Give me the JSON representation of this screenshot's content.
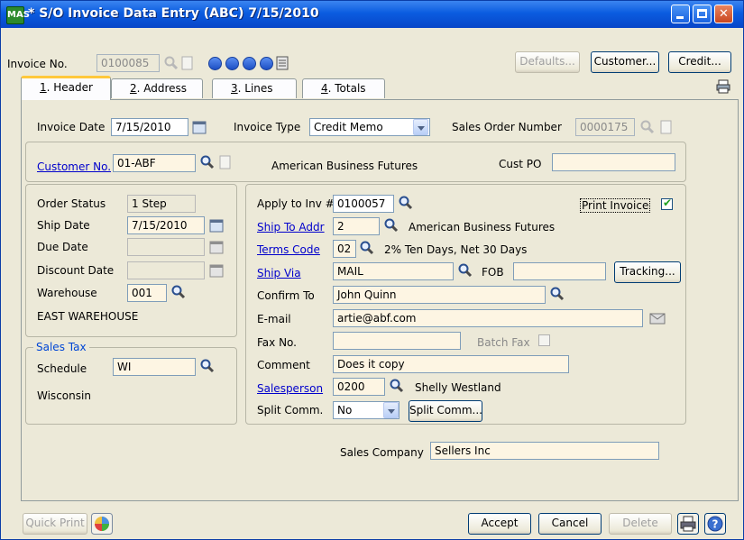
{
  "window": {
    "title": "* S/O Invoice Data Entry (ABC) 7/15/2010",
    "app_icon": "MAS"
  },
  "top": {
    "invoice_no_label": "Invoice No.",
    "invoice_no_value": "0100085",
    "defaults_button": "Defaults...",
    "customer_button": "Customer...",
    "credit_button": "Credit..."
  },
  "tabs": [
    {
      "num": "1",
      "label": ". Header"
    },
    {
      "num": "2",
      "label": ". Address"
    },
    {
      "num": "3",
      "label": ". Lines"
    },
    {
      "num": "4",
      "label": ". Totals"
    }
  ],
  "header": {
    "invoice_date_label": "Invoice Date",
    "invoice_date_value": "7/15/2010",
    "invoice_type_label": "Invoice Type",
    "invoice_type_value": "Credit Memo",
    "sales_order_number_label": "Sales Order Number",
    "sales_order_number_value": "0000175"
  },
  "customer": {
    "label": "Customer No.",
    "value": "01-ABF",
    "name": "American Business Futures",
    "cust_po_label": "Cust PO",
    "cust_po_value": ""
  },
  "left": {
    "order_status_label": "Order Status",
    "order_status_value": "1 Step",
    "ship_date_label": "Ship Date",
    "ship_date_value": "7/15/2010",
    "due_date_label": "Due Date",
    "due_date_value": "",
    "discount_date_label": "Discount Date",
    "discount_date_value": "",
    "warehouse_label": "Warehouse",
    "warehouse_value": "001",
    "warehouse_desc": "EAST WAREHOUSE"
  },
  "sales_tax": {
    "group_label": "Sales Tax",
    "schedule_label": "Schedule",
    "schedule_value": "WI",
    "schedule_desc": "Wisconsin"
  },
  "right": {
    "apply_to_inv_label": "Apply to Inv #",
    "apply_to_inv_value": "0100057",
    "print_invoice_label": "Print Invoice",
    "ship_to_addr_label": "Ship To Addr",
    "ship_to_addr_value": "2",
    "ship_to_addr_desc": "American Business Futures",
    "terms_code_label": "Terms Code",
    "terms_code_value": "02",
    "terms_code_desc": "2% Ten Days, Net 30 Days",
    "ship_via_label": "Ship Via",
    "ship_via_value": "MAIL",
    "fob_label": "FOB",
    "fob_value": "",
    "tracking_button": "Tracking...",
    "confirm_to_label": "Confirm To",
    "confirm_to_value": "John Quinn",
    "email_label": "E-mail",
    "email_value": "artie@abf.com",
    "fax_label": "Fax No.",
    "fax_value": "",
    "batch_fax_label": "Batch Fax",
    "comment_label": "Comment",
    "comment_value": "Does it copy",
    "salesperson_label": "Salesperson",
    "salesperson_value": "0200",
    "salesperson_desc": "Shelly Westland",
    "split_comm_label": "Split Comm.",
    "split_comm_value": "No",
    "split_comm_button": "Split Comm..."
  },
  "sales_company": {
    "label": "Sales Company",
    "value": "Sellers Inc"
  },
  "bottom": {
    "quick_print_button": "Quick Print",
    "accept_button": "Accept",
    "cancel_button": "Cancel",
    "delete_button": "Delete"
  }
}
